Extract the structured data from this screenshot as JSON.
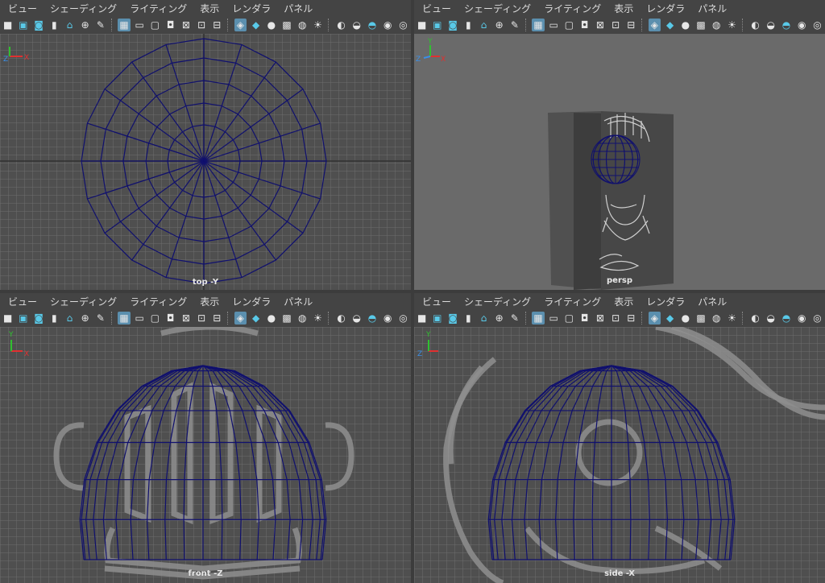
{
  "menu": [
    "ビュー",
    "シェーディング",
    "ライティング",
    "表示",
    "レンダラ",
    "パネル"
  ],
  "toolbar_icons": [
    "camera-icon",
    "camera-lock-icon",
    "camera-attr-icon",
    "bookmark-icon",
    "image-plane-icon",
    "pan-zoom-icon",
    "grease-pencil-icon",
    "sep",
    "grid-icon",
    "film-gate-icon",
    "resolution-gate-icon",
    "gate-mask-icon",
    "field-chart-icon",
    "safe-action-icon",
    "safe-title-icon",
    "sep",
    "wireframe-icon",
    "smooth-shade-icon",
    "default-material-icon",
    "textured-icon",
    "shadows-icon",
    "lights-icon",
    "sep",
    "xray-icon",
    "xray-joint-icon",
    "isolate-icon",
    "ambient-occlusion-icon",
    "motion-blur-icon"
  ],
  "panels": {
    "top": {
      "camera": "top -Y"
    },
    "persp": {
      "camera": "persp"
    },
    "front": {
      "camera": "front -Z"
    },
    "side": {
      "camera": "side -X"
    }
  },
  "colors": {
    "grid_bg": "#4f4f4f",
    "grid_line": "#6e6e6e",
    "wire": "#10106e",
    "persp_bg": "#6a6a6a"
  },
  "axes": {
    "x": "X",
    "y": "Y",
    "z": "Z"
  }
}
